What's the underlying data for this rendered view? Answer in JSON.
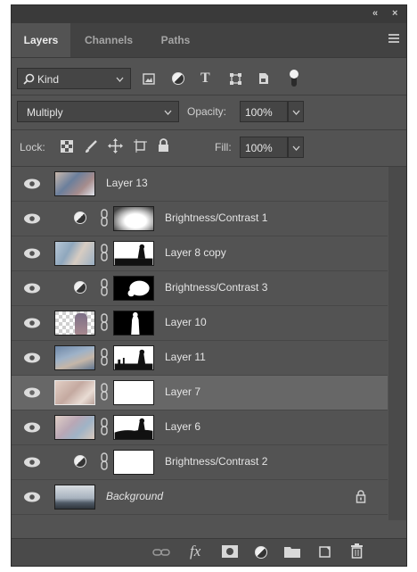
{
  "window": {
    "collapse_glyph": "«",
    "close_glyph": "×"
  },
  "tabs": [
    {
      "label": "Layers",
      "active": true
    },
    {
      "label": "Channels",
      "active": false
    },
    {
      "label": "Paths",
      "active": false
    }
  ],
  "filter": {
    "label": "Kind",
    "icons": [
      "image-filter-icon",
      "adjustment-filter-icon",
      "type-filter-icon",
      "shape-filter-icon",
      "smart-object-filter-icon",
      "filter-toggle-icon"
    ],
    "type_glyph": "T"
  },
  "blend": {
    "mode": "Multiply",
    "opacity_label": "Opacity:",
    "opacity_value": "100%"
  },
  "lock": {
    "label": "Lock:",
    "fill_label": "Fill:",
    "fill_value": "100%"
  },
  "layers": [
    {
      "name": "Layer 13"
    },
    {
      "name": "Brightness/Contrast 1"
    },
    {
      "name": "Layer 8 copy"
    },
    {
      "name": "Brightness/Contrast 3"
    },
    {
      "name": "Layer 10"
    },
    {
      "name": "Layer 11"
    },
    {
      "name": "Layer 7",
      "selected": true
    },
    {
      "name": "Layer 6"
    },
    {
      "name": "Brightness/Contrast 2"
    },
    {
      "name": "Background",
      "locked": true
    }
  ],
  "bottom_actions": [
    "link-layers-icon",
    "fx-icon",
    "add-mask-icon",
    "adjustment-layer-icon",
    "new-group-icon",
    "new-layer-icon",
    "delete-layer-icon"
  ],
  "bottom_fx_label": "fx",
  "colors": {
    "panel_bg": "#535353",
    "selected_row": "#676767",
    "tab_bar": "#424242"
  }
}
